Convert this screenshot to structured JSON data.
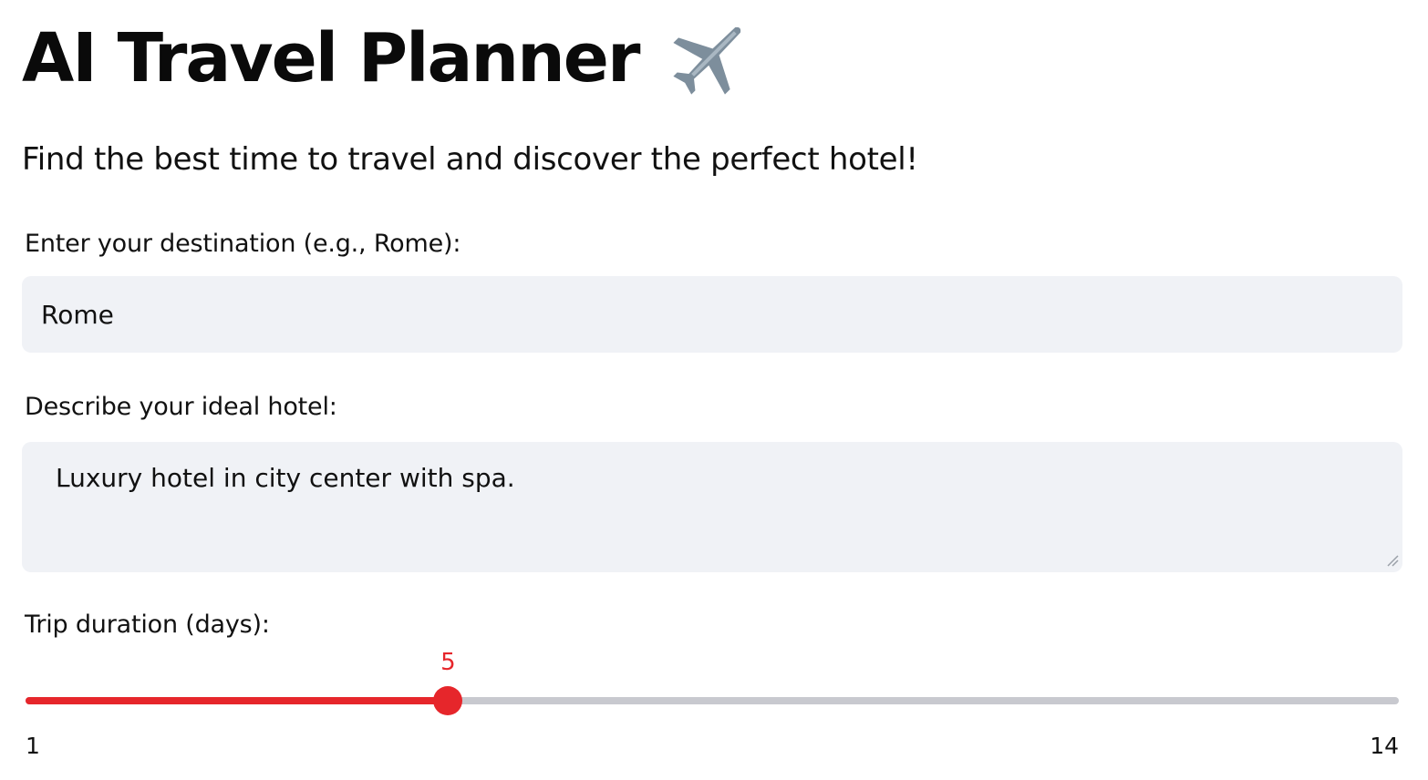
{
  "header": {
    "title": "AI Travel Planner",
    "title_icon": "airplane-icon",
    "subtitle": "Find the best time to travel and discover the perfect hotel!"
  },
  "destination": {
    "label": "Enter your destination (e.g., Rome):",
    "value": "Rome"
  },
  "hotel": {
    "label": "Describe your ideal hotel:",
    "value": "Luxury hotel in city center with spa."
  },
  "duration": {
    "label": "Trip duration (days):",
    "value": "5",
    "min": "1",
    "max": "14"
  },
  "colors": {
    "accent": "#e6262b",
    "input_background": "#f0f2f6",
    "track": "#c8c9cf"
  }
}
